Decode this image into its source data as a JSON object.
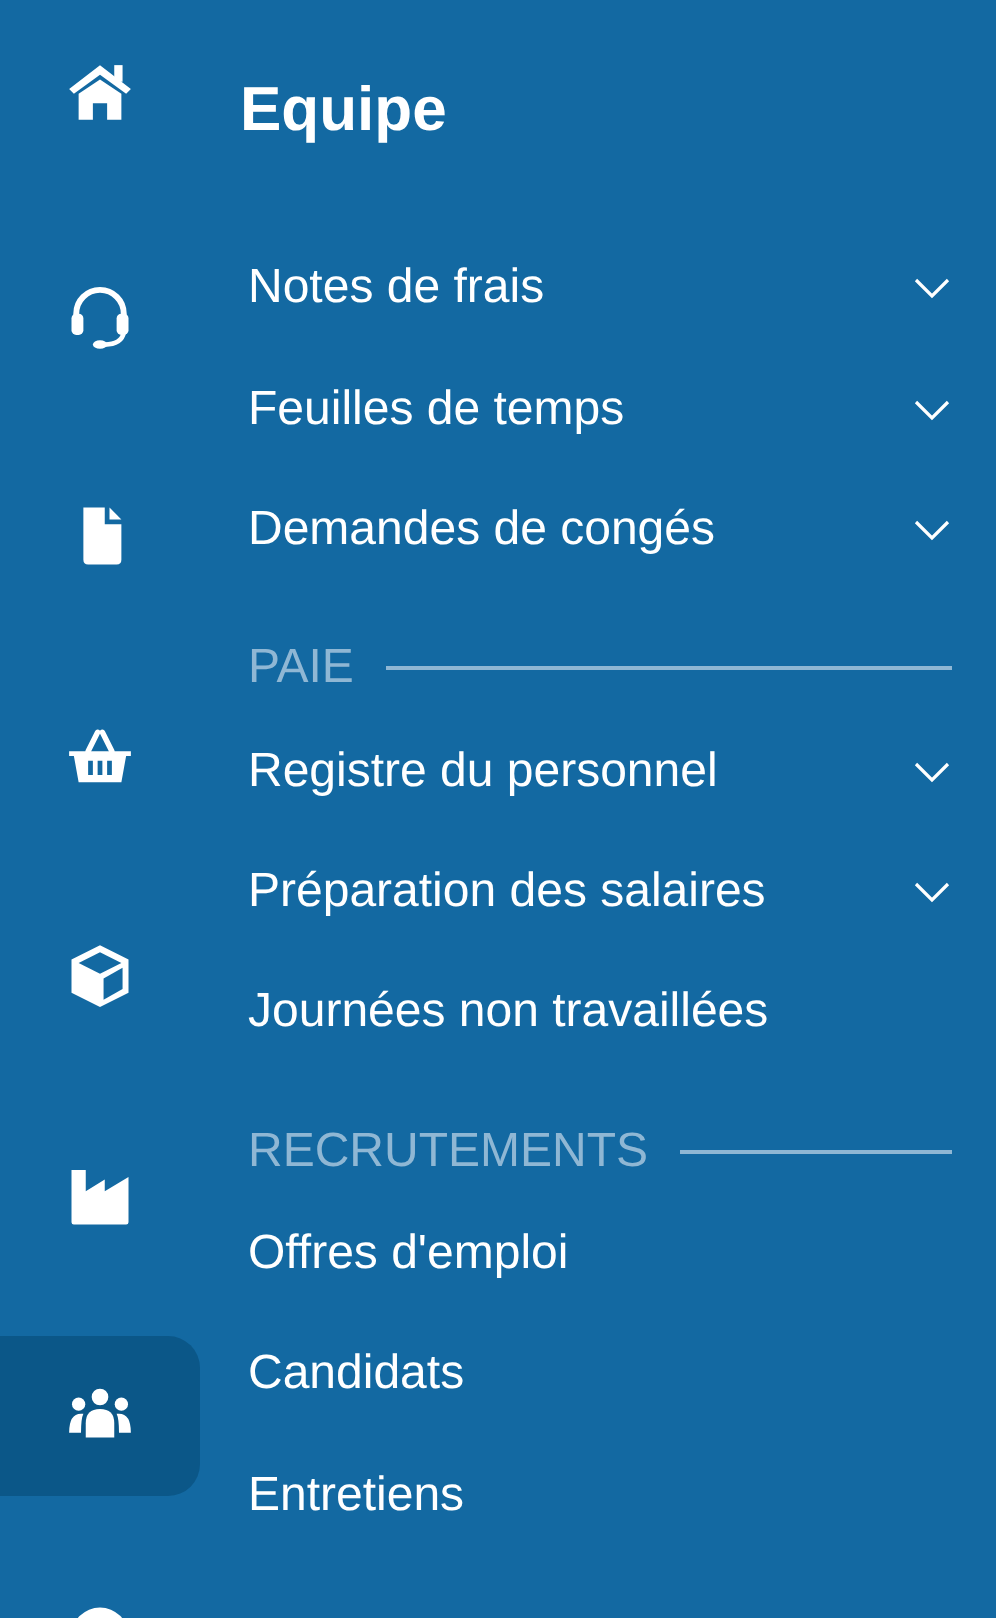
{
  "rail": [
    {
      "kind": "home",
      "selected": false
    },
    {
      "kind": "headset",
      "selected": false
    },
    {
      "kind": "file",
      "selected": false
    },
    {
      "kind": "basket",
      "selected": false
    },
    {
      "kind": "cube",
      "selected": false
    },
    {
      "kind": "factory",
      "selected": false
    },
    {
      "kind": "people",
      "selected": true
    },
    {
      "kind": "circle",
      "selected": false
    }
  ],
  "title": "Equipe",
  "sections": [
    {
      "items": [
        {
          "label": "Notes de frais",
          "expandable": true
        },
        {
          "label": "Feuilles de temps",
          "expandable": true
        },
        {
          "label": "Demandes de congés",
          "expandable": true
        }
      ]
    },
    {
      "header": "PAIE",
      "items": [
        {
          "label": "Registre du personnel",
          "expandable": true
        },
        {
          "label": "Préparation des salaires",
          "expandable": true
        },
        {
          "label": "Journées non travaillées",
          "expandable": false
        }
      ]
    },
    {
      "header": "RECRUTEMENTS",
      "items": [
        {
          "label": "Offres d'emploi",
          "expandable": false
        },
        {
          "label": "Candidats",
          "expandable": false
        },
        {
          "label": "Entretiens",
          "expandable": false
        }
      ]
    }
  ]
}
